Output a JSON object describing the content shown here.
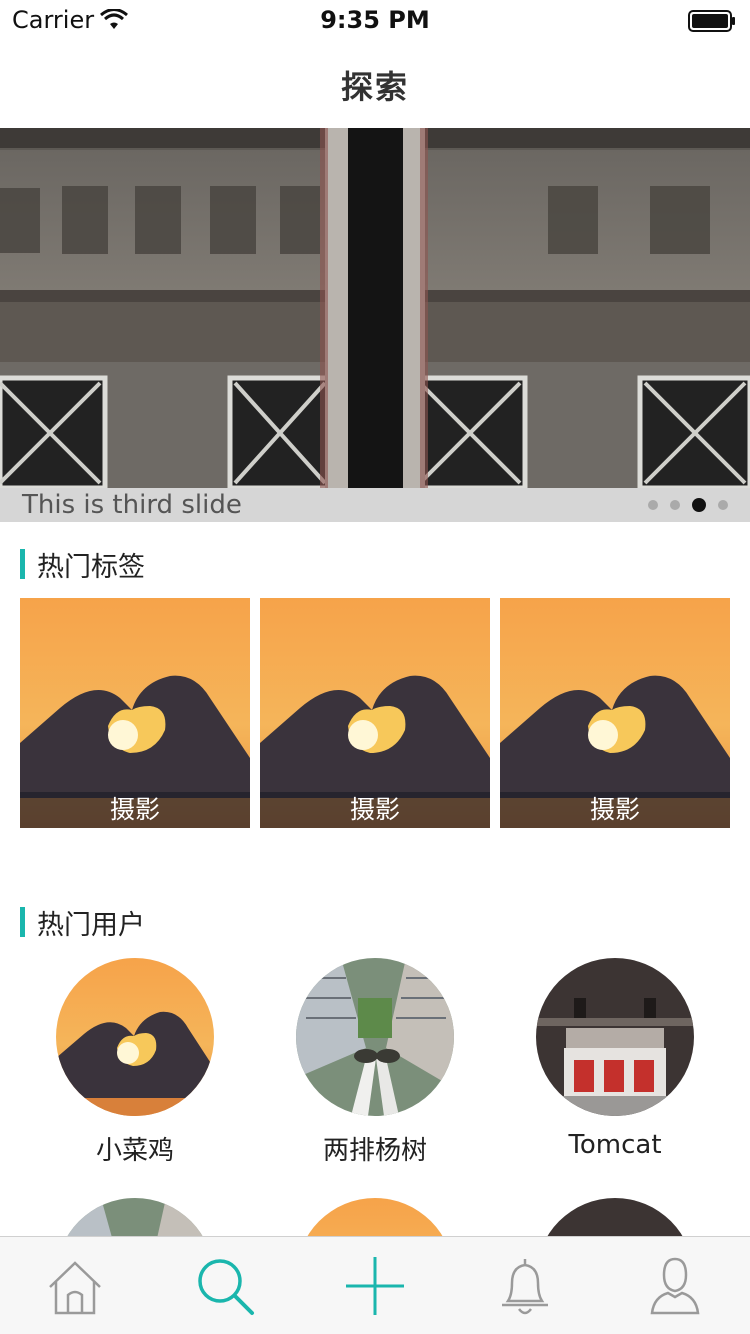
{
  "status_bar": {
    "carrier": "Carrier",
    "time": "9:35 PM"
  },
  "nav": {
    "title": "探索"
  },
  "carousel": {
    "caption": "This is third slide",
    "slide_count": 4,
    "active_index": 2
  },
  "hot_tags": {
    "title": "热门标签",
    "items": [
      {
        "label": "摄影"
      },
      {
        "label": "摄影"
      },
      {
        "label": "摄影"
      }
    ]
  },
  "hot_users": {
    "title": "热门用户",
    "items": [
      {
        "name": "小菜鸡"
      },
      {
        "name": "两排杨树"
      },
      {
        "name": "Tomcat"
      }
    ]
  },
  "tab_bar": {
    "items": [
      {
        "icon": "home-icon"
      },
      {
        "icon": "search-icon"
      },
      {
        "icon": "plus-icon"
      },
      {
        "icon": "bell-icon"
      },
      {
        "icon": "user-icon"
      }
    ],
    "active_color": "#1ab6ad",
    "inactive_color": "#999999"
  },
  "colors": {
    "accent": "#1ab6ad"
  }
}
